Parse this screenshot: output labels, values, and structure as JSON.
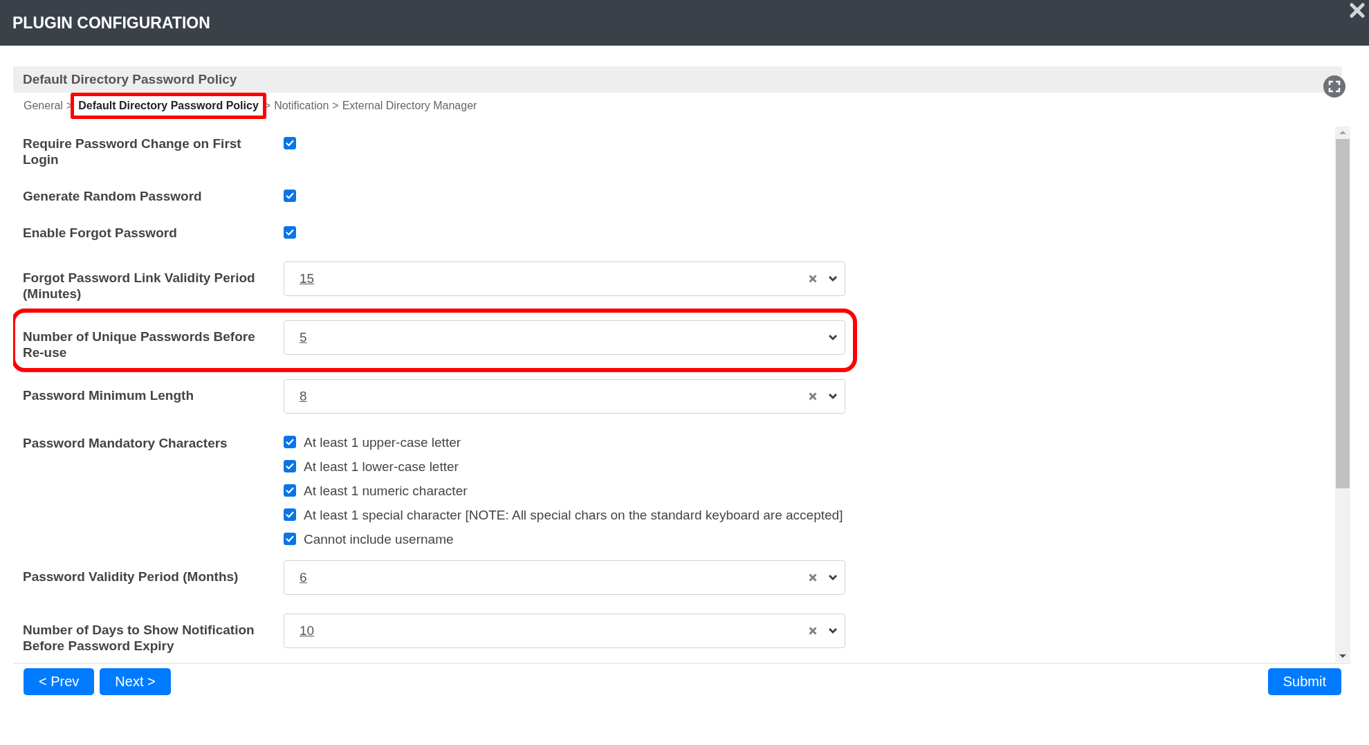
{
  "window": {
    "title": "PLUGIN CONFIGURATION"
  },
  "section": {
    "title": "Default Directory Password Policy"
  },
  "breadcrumb": {
    "items": [
      {
        "label": "General",
        "selected": false,
        "highlighted": false
      },
      {
        "label": "Default Directory Password Policy",
        "selected": true,
        "highlighted": true
      },
      {
        "label": "Notification",
        "selected": false,
        "highlighted": false
      },
      {
        "label": "External Directory Manager",
        "selected": false,
        "highlighted": false
      }
    ],
    "separators": [
      ">",
      ">",
      ">"
    ]
  },
  "fields": [
    {
      "kind": "checkbox",
      "label": "Require Password Change on First Login",
      "checked": true,
      "highlighted": false
    },
    {
      "kind": "checkbox",
      "label": "Generate Random Password",
      "checked": true,
      "highlighted": false
    },
    {
      "kind": "checkbox",
      "label": "Enable Forgot Password",
      "checked": true,
      "highlighted": false
    },
    {
      "kind": "select",
      "label": "Forgot Password Link Validity Period (Minutes)",
      "value": "15",
      "clearable": true,
      "highlighted": false
    },
    {
      "kind": "select",
      "label": "Number of Unique Passwords Before Re-use",
      "value": "5",
      "clearable": false,
      "highlighted": true
    },
    {
      "kind": "select",
      "label": "Password Minimum Length",
      "value": "8",
      "clearable": true,
      "highlighted": false
    },
    {
      "kind": "checklist",
      "label": "Password Mandatory Characters",
      "highlighted": false,
      "options": [
        {
          "label": "At least 1 upper-case letter",
          "checked": true
        },
        {
          "label": "At least 1 lower-case letter",
          "checked": true
        },
        {
          "label": "At least 1 numeric character",
          "checked": true
        },
        {
          "label": "At least 1 special character [NOTE: All special chars on the standard keyboard are accepted]",
          "checked": true
        },
        {
          "label": "Cannot include username",
          "checked": true
        }
      ]
    },
    {
      "kind": "select",
      "label": "Password Validity Period (Months)",
      "value": "6",
      "clearable": true,
      "highlighted": false
    },
    {
      "kind": "select",
      "label": "Number of Days to Show Notification Before Password Expiry",
      "value": "10",
      "clearable": true,
      "highlighted": false
    }
  ],
  "footer": {
    "left_buttons": [
      "< Prev",
      "Next >"
    ],
    "right_button": "Submit"
  }
}
